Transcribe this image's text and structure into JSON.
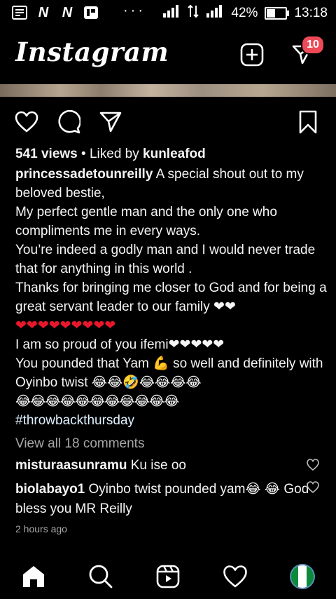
{
  "status_bar": {
    "left_glyphs": [
      "N",
      "N"
    ],
    "dots": "···",
    "battery_text": "42%",
    "battery_level": 0.42,
    "time": "13:18"
  },
  "header": {
    "logo": "Instagram",
    "notification_count": "10"
  },
  "post": {
    "views": "541 views",
    "liked_by_prefix": " • Liked by ",
    "liked_by_user": "kunleafod",
    "caption_user": "princessadetounreilly",
    "caption_lines": [
      " A special shout out to my beloved bestie,",
      "My perfect gentle man and the only one who compliments me in every ways.",
      "You’re indeed a godly man and I would never trade that for anything in this world .",
      "Thanks for bringing me closer to God and for being a great servant leader to our family ❤❤",
      "❤❤❤❤❤❤❤❤❤",
      "I am so proud of you ifemi❤❤❤❤❤",
      "You pounded that Yam 💪 so well and definitely with Oyinbo twist 😂😂🤣😂😂😂😂",
      "😂😂😂😂😂😂😂😂😂😂😂"
    ],
    "hashtag": "#throwbackthursday",
    "view_all": "View all 18 comments",
    "comments": [
      {
        "user": "misturaasunramu",
        "text": " Ku ise oo"
      },
      {
        "user": "biolabayo1",
        "text": " Oyinbo twist pounded yam😂 😂 God bless you MR Reilly"
      }
    ],
    "time_ago": "2 hours ago"
  }
}
